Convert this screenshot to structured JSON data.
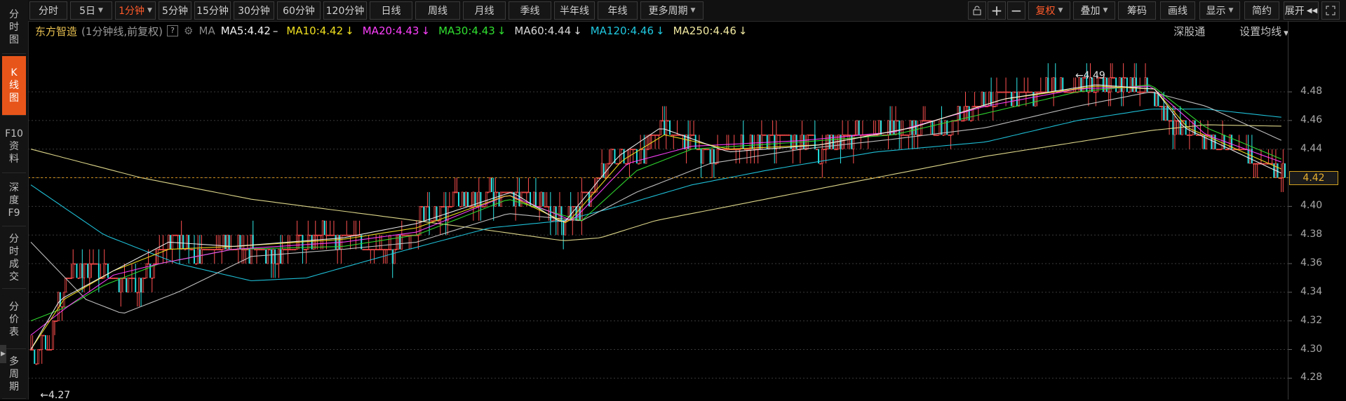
{
  "left_tabs": [
    {
      "label": "分\n时\n图",
      "active": false
    },
    {
      "label": "K\n线\n图",
      "active": true
    },
    {
      "label": "F10\n资\n料",
      "active": false
    },
    {
      "label": "深\n度\nF9",
      "active": false
    },
    {
      "label": "分\n时\n成\n交",
      "active": false
    },
    {
      "label": "分\n价\n表",
      "active": false
    },
    {
      "label": "多\n周\n期",
      "active": false
    }
  ],
  "periods": [
    "分时",
    "5日",
    "1分钟",
    "5分钟",
    "15分钟",
    "30分钟",
    "60分钟",
    "120分钟",
    "日线",
    "周线",
    "月线",
    "季线",
    "半年线",
    "年线",
    "更多周期"
  ],
  "active_period": "1分钟",
  "toolbar_right": {
    "fuquan": "复权",
    "overlay": "叠加",
    "chips": "筹码",
    "draw": "画线",
    "display": "显示",
    "summary": "简约",
    "expand": "展开"
  },
  "stock": {
    "name": "东方智造",
    "sub": "(1分钟线,前复权)",
    "help": "?",
    "ma_label": "MA"
  },
  "ma_legend": [
    {
      "text": "MA5:4.42",
      "arrow": "–",
      "color": "#f0f0f0"
    },
    {
      "text": "MA10:4.42",
      "arrow": "↓",
      "color": "#f0e020"
    },
    {
      "text": "MA20:4.43",
      "arrow": "↓",
      "color": "#ff40ff"
    },
    {
      "text": "MA30:4.43",
      "arrow": "↓",
      "color": "#30e030"
    },
    {
      "text": "MA60:4.44",
      "arrow": "↓",
      "color": "#d8d8d8"
    },
    {
      "text": "MA120:4.46",
      "arrow": "↓",
      "color": "#20c8e0"
    },
    {
      "text": "MA250:4.46",
      "arrow": "↓",
      "color": "#f0e8a0"
    }
  ],
  "right_links": {
    "shengu": "深股通",
    "setma": "设置均线"
  },
  "chart_data": {
    "type": "candlestick",
    "ylim": [
      4.265,
      4.505
    ],
    "y_ticks": [
      "4.48",
      "4.46",
      "4.44",
      "4.42",
      "4.40",
      "4.38",
      "4.36",
      "4.34",
      "4.32",
      "4.30",
      "4.28"
    ],
    "current_price": "4.42",
    "high_annotation": "4.49",
    "low_annotation": "4.27",
    "close_path": [
      [
        0,
        4.3
      ],
      [
        3,
        4.29
      ],
      [
        6,
        4.31
      ],
      [
        10,
        4.3
      ],
      [
        14,
        4.33
      ],
      [
        18,
        4.34
      ],
      [
        22,
        4.355
      ],
      [
        30,
        4.36
      ],
      [
        40,
        4.355
      ],
      [
        48,
        4.35
      ],
      [
        58,
        4.345
      ],
      [
        66,
        4.355
      ],
      [
        72,
        4.37
      ],
      [
        78,
        4.38
      ],
      [
        82,
        4.375
      ],
      [
        90,
        4.37
      ],
      [
        100,
        4.37
      ],
      [
        110,
        4.375
      ],
      [
        120,
        4.37
      ],
      [
        130,
        4.365
      ],
      [
        140,
        4.37
      ],
      [
        150,
        4.375
      ],
      [
        160,
        4.38
      ],
      [
        170,
        4.378
      ],
      [
        180,
        4.375
      ],
      [
        190,
        4.37
      ],
      [
        195,
        4.365
      ],
      [
        202,
        4.375
      ],
      [
        210,
        4.39
      ],
      [
        220,
        4.395
      ],
      [
        230,
        4.4
      ],
      [
        240,
        4.405
      ],
      [
        250,
        4.41
      ],
      [
        260,
        4.405
      ],
      [
        270,
        4.41
      ],
      [
        278,
        4.405
      ],
      [
        285,
        4.395
      ],
      [
        290,
        4.39
      ],
      [
        296,
        4.395
      ],
      [
        305,
        4.41
      ],
      [
        315,
        4.43
      ],
      [
        325,
        4.435
      ],
      [
        335,
        4.44
      ],
      [
        342,
        4.455
      ],
      [
        348,
        4.45
      ],
      [
        355,
        4.445
      ],
      [
        365,
        4.44
      ],
      [
        372,
        4.435
      ],
      [
        382,
        4.44
      ],
      [
        395,
        4.445
      ],
      [
        410,
        4.45
      ],
      [
        420,
        4.445
      ],
      [
        430,
        4.44
      ],
      [
        440,
        4.445
      ],
      [
        450,
        4.45
      ],
      [
        465,
        4.452
      ],
      [
        480,
        4.455
      ],
      [
        495,
        4.455
      ],
      [
        505,
        4.46
      ],
      [
        515,
        4.47
      ],
      [
        525,
        4.475
      ],
      [
        535,
        4.48
      ],
      [
        545,
        4.478
      ],
      [
        555,
        4.482
      ],
      [
        565,
        4.48
      ],
      [
        575,
        4.485
      ],
      [
        585,
        4.485
      ],
      [
        595,
        4.487
      ],
      [
        605,
        4.485
      ],
      [
        612,
        4.48
      ],
      [
        618,
        4.465
      ],
      [
        625,
        4.455
      ],
      [
        635,
        4.45
      ],
      [
        645,
        4.445
      ],
      [
        655,
        4.44
      ],
      [
        665,
        4.435
      ],
      [
        672,
        4.43
      ],
      [
        678,
        4.425
      ],
      [
        683,
        4.42
      ]
    ],
    "ma_series": [
      {
        "name": "MA250",
        "color": "#e8e090",
        "points": [
          [
            0,
            4.44
          ],
          [
            60,
            4.42
          ],
          [
            120,
            4.405
          ],
          [
            180,
            4.395
          ],
          [
            240,
            4.385
          ],
          [
            290,
            4.376
          ],
          [
            310,
            4.378
          ],
          [
            340,
            4.39
          ],
          [
            400,
            4.405
          ],
          [
            460,
            4.42
          ],
          [
            520,
            4.435
          ],
          [
            580,
            4.447
          ],
          [
            610,
            4.453
          ],
          [
            640,
            4.457
          ],
          [
            683,
            4.456
          ]
        ]
      },
      {
        "name": "MA120",
        "color": "#20c8e0",
        "points": [
          [
            0,
            4.415
          ],
          [
            40,
            4.38
          ],
          [
            80,
            4.36
          ],
          [
            120,
            4.348
          ],
          [
            150,
            4.35
          ],
          [
            200,
            4.368
          ],
          [
            250,
            4.385
          ],
          [
            290,
            4.39
          ],
          [
            320,
            4.4
          ],
          [
            360,
            4.415
          ],
          [
            400,
            4.425
          ],
          [
            460,
            4.438
          ],
          [
            520,
            4.445
          ],
          [
            570,
            4.46
          ],
          [
            610,
            4.468
          ],
          [
            640,
            4.468
          ],
          [
            683,
            4.462
          ]
        ]
      },
      {
        "name": "MA60",
        "color": "#c8c8c8",
        "points": [
          [
            0,
            4.375
          ],
          [
            30,
            4.335
          ],
          [
            50,
            4.325
          ],
          [
            80,
            4.34
          ],
          [
            120,
            4.365
          ],
          [
            170,
            4.37
          ],
          [
            210,
            4.375
          ],
          [
            260,
            4.395
          ],
          [
            300,
            4.39
          ],
          [
            330,
            4.41
          ],
          [
            370,
            4.43
          ],
          [
            420,
            4.44
          ],
          [
            470,
            4.447
          ],
          [
            520,
            4.455
          ],
          [
            570,
            4.47
          ],
          [
            610,
            4.48
          ],
          [
            640,
            4.47
          ],
          [
            683,
            4.445
          ]
        ]
      },
      {
        "name": "MA30",
        "color": "#30e030",
        "points": [
          [
            0,
            4.32
          ],
          [
            20,
            4.33
          ],
          [
            40,
            4.345
          ],
          [
            70,
            4.36
          ],
          [
            110,
            4.37
          ],
          [
            170,
            4.372
          ],
          [
            210,
            4.38
          ],
          [
            260,
            4.405
          ],
          [
            300,
            4.39
          ],
          [
            330,
            4.425
          ],
          [
            360,
            4.44
          ],
          [
            420,
            4.445
          ],
          [
            470,
            4.45
          ],
          [
            520,
            4.465
          ],
          [
            570,
            4.48
          ],
          [
            610,
            4.485
          ],
          [
            640,
            4.455
          ],
          [
            683,
            4.432
          ]
        ]
      },
      {
        "name": "MA20",
        "color": "#ff40ff",
        "points": [
          [
            0,
            4.31
          ],
          [
            20,
            4.33
          ],
          [
            45,
            4.352
          ],
          [
            70,
            4.36
          ],
          [
            110,
            4.37
          ],
          [
            170,
            4.375
          ],
          [
            210,
            4.382
          ],
          [
            260,
            4.408
          ],
          [
            295,
            4.39
          ],
          [
            325,
            4.43
          ],
          [
            360,
            4.442
          ],
          [
            420,
            4.446
          ],
          [
            470,
            4.452
          ],
          [
            520,
            4.47
          ],
          [
            570,
            4.482
          ],
          [
            610,
            4.484
          ],
          [
            640,
            4.45
          ],
          [
            683,
            4.43
          ]
        ]
      },
      {
        "name": "MA10",
        "color": "#f0e020",
        "points": [
          [
            0,
            4.3
          ],
          [
            18,
            4.335
          ],
          [
            45,
            4.355
          ],
          [
            75,
            4.37
          ],
          [
            110,
            4.372
          ],
          [
            170,
            4.377
          ],
          [
            210,
            4.385
          ],
          [
            260,
            4.408
          ],
          [
            292,
            4.388
          ],
          [
            322,
            4.432
          ],
          [
            345,
            4.45
          ],
          [
            380,
            4.44
          ],
          [
            430,
            4.443
          ],
          [
            480,
            4.455
          ],
          [
            530,
            4.475
          ],
          [
            580,
            4.484
          ],
          [
            612,
            4.482
          ],
          [
            630,
            4.455
          ],
          [
            683,
            4.425
          ]
        ]
      },
      {
        "name": "MA5",
        "color": "#f0f0f0",
        "points": [
          [
            0,
            4.3
          ],
          [
            16,
            4.335
          ],
          [
            45,
            4.355
          ],
          [
            75,
            4.375
          ],
          [
            110,
            4.372
          ],
          [
            170,
            4.378
          ],
          [
            210,
            4.388
          ],
          [
            262,
            4.41
          ],
          [
            290,
            4.388
          ],
          [
            320,
            4.435
          ],
          [
            343,
            4.455
          ],
          [
            380,
            4.438
          ],
          [
            430,
            4.443
          ],
          [
            480,
            4.455
          ],
          [
            530,
            4.475
          ],
          [
            580,
            4.485
          ],
          [
            612,
            4.482
          ],
          [
            628,
            4.455
          ],
          [
            683,
            4.422
          ]
        ]
      }
    ]
  }
}
